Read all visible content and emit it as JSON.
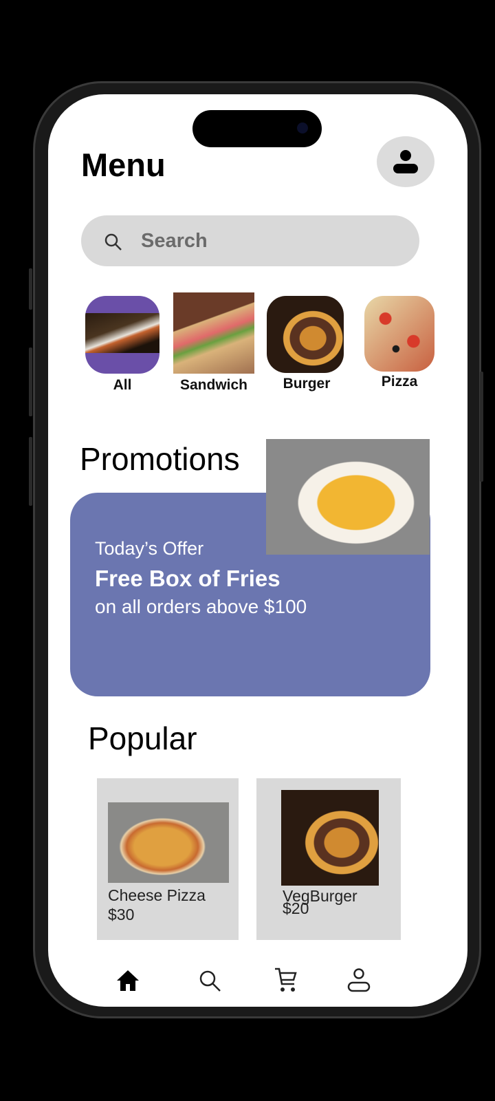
{
  "header": {
    "title": "Menu",
    "profile_icon": "person-icon"
  },
  "search": {
    "placeholder": "Search"
  },
  "categories": [
    {
      "label": "All",
      "selected": true
    },
    {
      "label": "Sandwich"
    },
    {
      "label": "Burger"
    },
    {
      "label": "Pizza"
    }
  ],
  "promotions": {
    "title": "Promotions",
    "line1": "Today’s Offer",
    "line2": "Free Box of Fries",
    "line3": "on all orders above $100",
    "color": "#6b76b0"
  },
  "popular": {
    "title": "Popular",
    "items": [
      {
        "name": "Cheese Pizza",
        "price": "$30"
      },
      {
        "name": "VegBurger",
        "price": "$20"
      }
    ]
  },
  "bottom_nav": [
    "home-icon",
    "search-icon",
    "cart-icon",
    "profile-icon"
  ],
  "accent": "#6a4fa8"
}
